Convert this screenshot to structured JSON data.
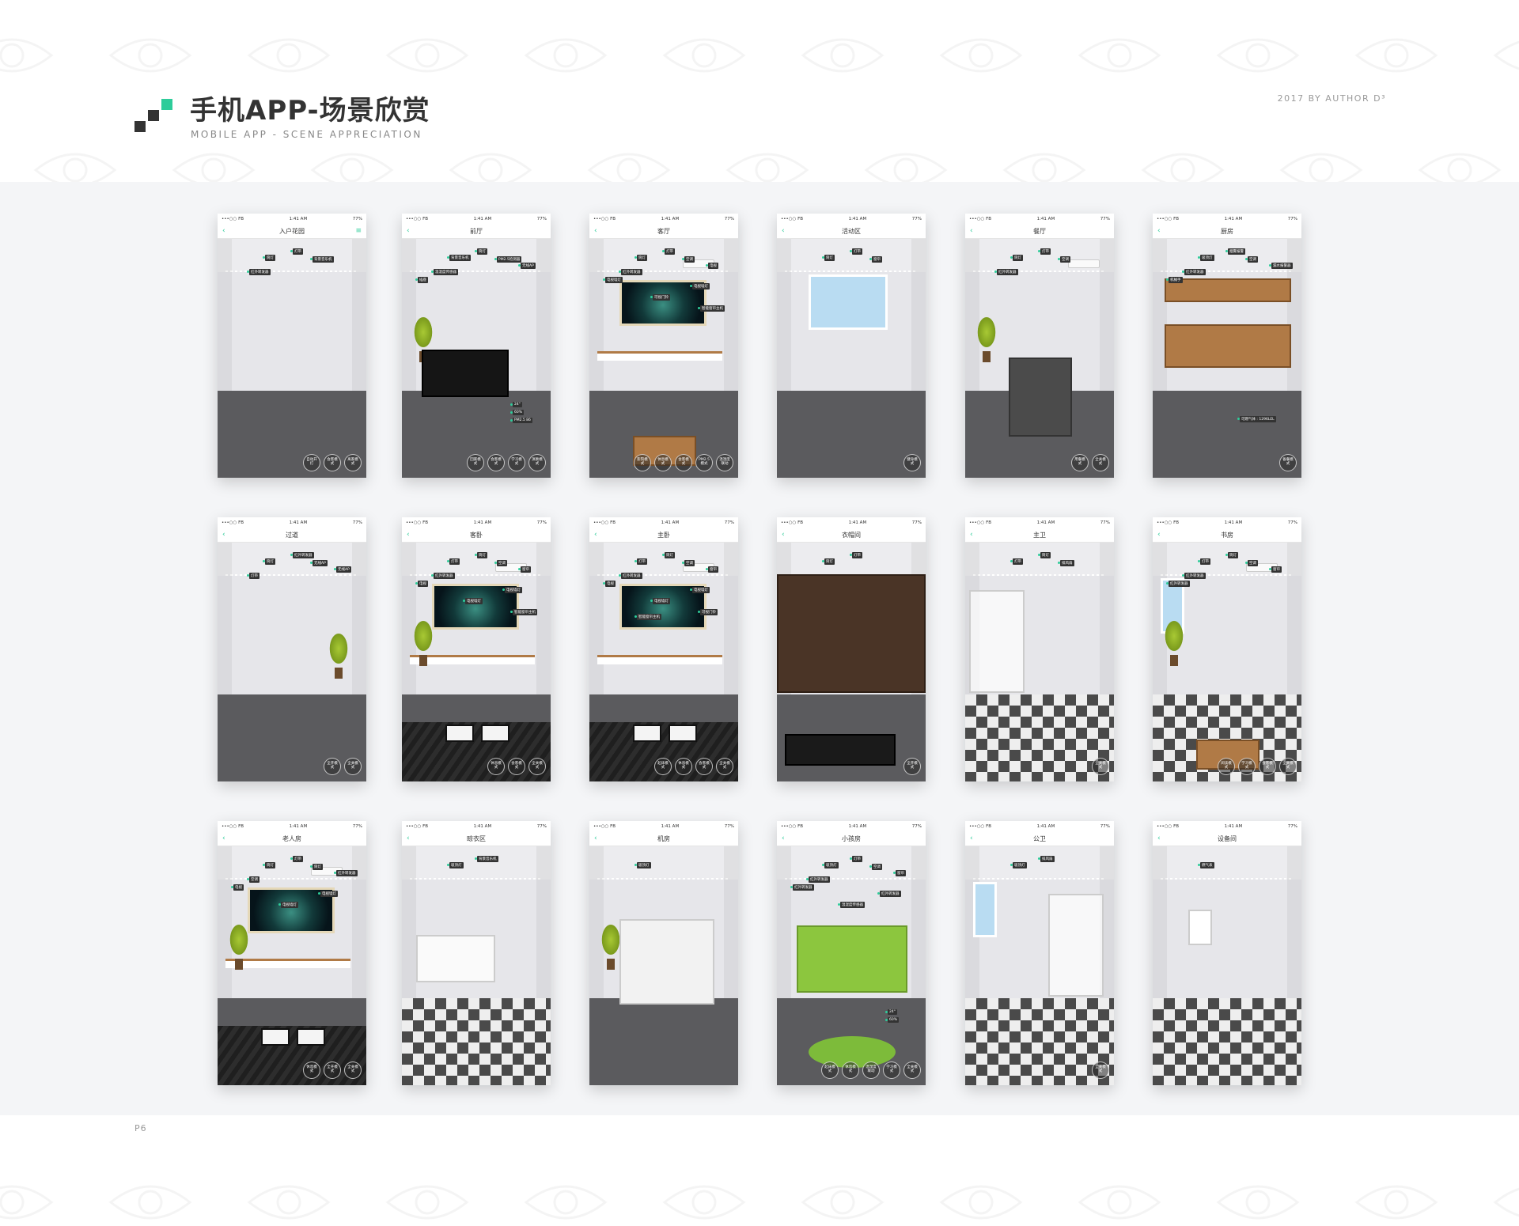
{
  "header": {
    "title": "手机APP-场景欣赏",
    "subtitle": "MOBILE APP - SCENE APPRECIATION",
    "byline": "2017 BY AUTHOR D³",
    "page": "P6"
  },
  "colors": {
    "accent": "#2ecc9a",
    "dark": "#333333",
    "panel": "#f4f5f7"
  },
  "status": {
    "carrier": "•••○○ FB",
    "time": "1:41 AM",
    "battery": "77%"
  },
  "screens": [
    {
      "title": "入户花园",
      "tags": [
        "筒灯",
        "灯带",
        "背景音乐机",
        "红外转发器"
      ],
      "buttons": [
        "自动开灯",
        "会客模式",
        "离家模式"
      ]
    },
    {
      "title": "前厅",
      "tags": [
        "背景音乐机",
        "筒灯",
        "PM2.5检测器",
        "温湿度传感器",
        "无线AP",
        "插座"
      ],
      "buttons": [
        "回家模式",
        "会客模式",
        "学习模式",
        "演奏模式"
      ],
      "readouts": [
        "24°",
        "60%",
        "PM2.5 86"
      ]
    },
    {
      "title": "客厅",
      "tags": [
        "筒灯",
        "灯带",
        "空调",
        "红外转发器",
        "电视",
        "电视墙灯",
        "电视墙灯",
        "可视门铃",
        "智能窗帘主机"
      ],
      "buttons": [
        "影院模式",
        "休息模式",
        "会客模式",
        "PM2.5模式",
        "温湿度联动"
      ]
    },
    {
      "title": "活动区",
      "tags": [
        "筒灯",
        "灯带",
        "窗帘"
      ],
      "buttons": [
        "健身模式"
      ]
    },
    {
      "title": "餐厅",
      "tags": [
        "筒灯",
        "灯带",
        "空调",
        "红外转发器"
      ],
      "buttons": [
        "用餐模式",
        "全关模式"
      ]
    },
    {
      "title": "厨房",
      "tags": [
        "吸顶灯",
        "烟雾报警",
        "空调",
        "红外转发器",
        "漏水报警器",
        "机械手"
      ],
      "buttons": [
        "备餐模式"
      ],
      "readouts": [
        "可燃气体 : 1296LEL"
      ]
    },
    {
      "title": "过道",
      "tags": [
        "筒灯",
        "红外转发器",
        "无线AP",
        "灯带",
        "无线AP"
      ],
      "buttons": [
        "全开模式",
        "全关模式"
      ]
    },
    {
      "title": "客卧",
      "tags": [
        "灯带",
        "筒灯",
        "空调",
        "红外转发器",
        "窗帘",
        "电视",
        "电视墙灯",
        "电视墙灯",
        "智能窗帘主机"
      ],
      "buttons": [
        "休息模式",
        "会客模式",
        "全关模式"
      ]
    },
    {
      "title": "主卧",
      "tags": [
        "灯带",
        "筒灯",
        "空调",
        "红外转发器",
        "窗帘",
        "电视",
        "电视墙灯",
        "电视墙灯",
        "可视门铃",
        "智能窗帘主机"
      ],
      "buttons": [
        "起床模式",
        "休息模式",
        "会客模式",
        "全关模式"
      ]
    },
    {
      "title": "衣帽间",
      "tags": [
        "筒灯",
        "灯带"
      ],
      "buttons": [
        "全开模式"
      ]
    },
    {
      "title": "主卫",
      "tags": [
        "灯带",
        "筒灯",
        "排风扇"
      ],
      "buttons": [
        "全关模式"
      ]
    },
    {
      "title": "书房",
      "tags": [
        "灯带",
        "筒灯",
        "空调",
        "红外转发器",
        "窗帘",
        "红外转发器"
      ],
      "buttons": [
        "阅读模式",
        "学习模式",
        "会客模式",
        "全关模式"
      ]
    },
    {
      "title": "老人房",
      "tags": [
        "筒灯",
        "灯带",
        "筒灯",
        "空调",
        "红外转发器",
        "电视",
        "电视墙灯",
        "电视墙灯"
      ],
      "buttons": [
        "休息模式",
        "全开模式",
        "全关模式"
      ]
    },
    {
      "title": "晾衣区",
      "tags": [
        "吸顶灯",
        "背景音乐机"
      ],
      "buttons": []
    },
    {
      "title": "机房",
      "tags": [
        "吸顶灯"
      ],
      "buttons": []
    },
    {
      "title": "小孩房",
      "tags": [
        "吸顶灯",
        "灯带",
        "空调",
        "红外转发器",
        "窗帘",
        "红外转发器",
        "红外转发器",
        "温湿度传感器"
      ],
      "buttons": [
        "起床模式",
        "休息模式",
        "温湿度联动",
        "学习模式",
        "全关模式"
      ],
      "readouts": [
        "24°",
        "60%"
      ]
    },
    {
      "title": "公卫",
      "tags": [
        "吸顶灯",
        "排风扇"
      ],
      "buttons": [
        "全关模式"
      ]
    },
    {
      "title": "设备间",
      "tags": [
        "燃气表"
      ],
      "buttons": []
    }
  ]
}
